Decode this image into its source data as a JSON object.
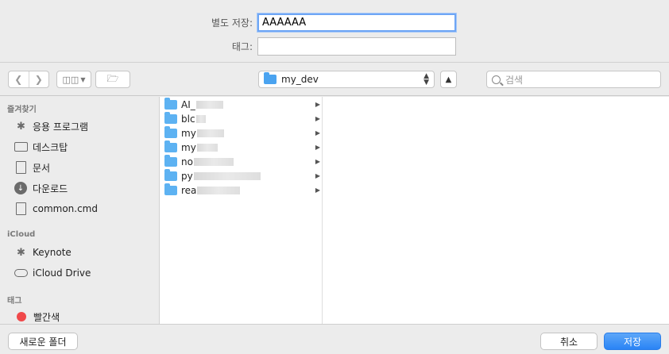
{
  "save_as": {
    "label": "별도 저장:",
    "value": "AAAAAA"
  },
  "tags": {
    "label": "태그:",
    "value": ""
  },
  "toolbar": {
    "back_icon": "chevron-left-icon",
    "forward_icon": "chevron-right-icon",
    "view_icon": "columns-view-icon",
    "path": "my_dev",
    "search_placeholder": "검색"
  },
  "sidebar": {
    "favorites_header": "즐겨찾기",
    "favorites": [
      "응용 프로그램",
      "데스크탑",
      "문서",
      "다운로드",
      "common.cmd"
    ],
    "icloud_header": "iCloud",
    "icloud": [
      "Keynote",
      "iCloud Drive"
    ],
    "tags_header": "태그",
    "tags": [
      "빨간색"
    ]
  },
  "files": [
    {
      "prefix": "AI_"
    },
    {
      "prefix": "blc"
    },
    {
      "prefix": "my"
    },
    {
      "prefix": "my"
    },
    {
      "prefix": "no"
    },
    {
      "prefix": "py"
    },
    {
      "prefix": "rea"
    }
  ],
  "buttons": {
    "new_folder": "새로운 폴더",
    "cancel": "취소",
    "save": "저장"
  },
  "colors": {
    "accent": "#2a84f5",
    "folder": "#5db2f2",
    "tag_red": "#f0484a"
  }
}
